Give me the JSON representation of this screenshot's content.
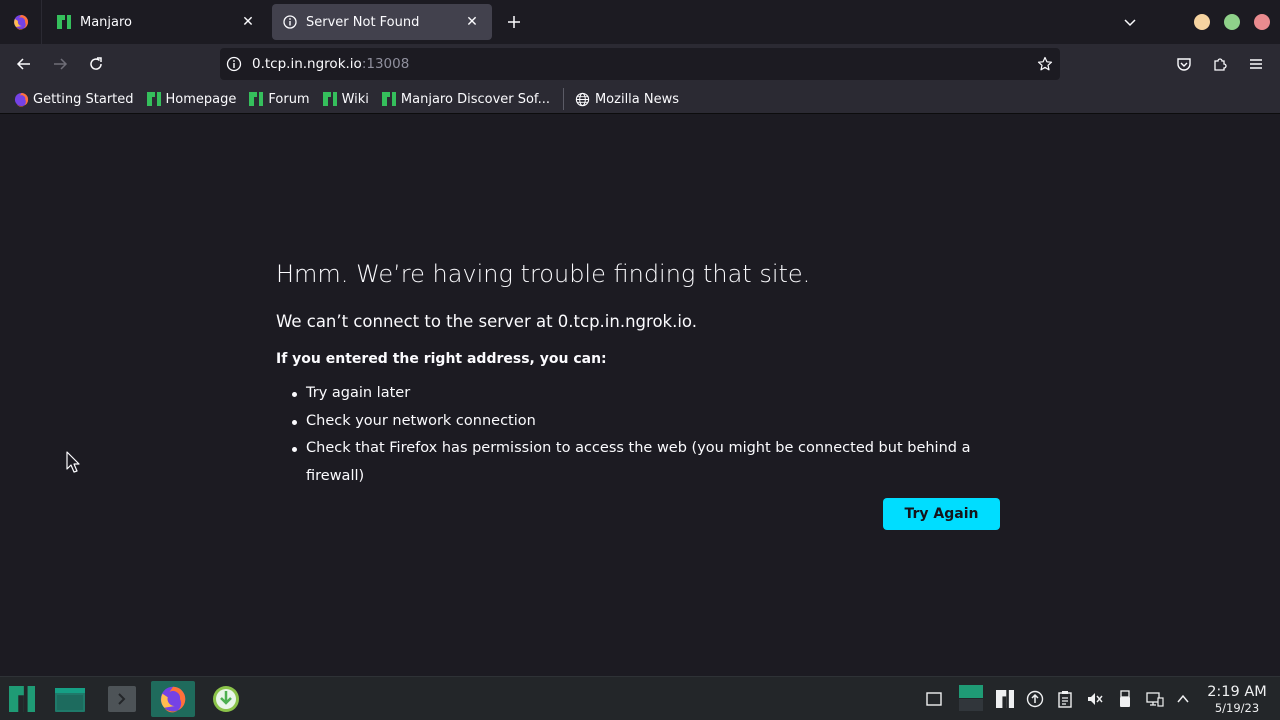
{
  "tabs": [
    {
      "title": "Manjaro",
      "icon": "manjaro-icon",
      "active": false
    },
    {
      "title": "Server Not Found",
      "icon": "info-icon",
      "active": true
    }
  ],
  "url": {
    "host": "0.tcp.in.ngrok.io",
    "port": ":13008"
  },
  "bookmarks": [
    {
      "label": "Getting Started",
      "icon": "firefox-icon"
    },
    {
      "label": "Homepage",
      "icon": "manjaro-icon"
    },
    {
      "label": "Forum",
      "icon": "manjaro-icon"
    },
    {
      "label": "Wiki",
      "icon": "manjaro-icon"
    },
    {
      "label": "Manjaro Discover Sof...",
      "icon": "manjaro-icon"
    },
    {
      "label": "Mozilla News",
      "icon": "globe-icon"
    }
  ],
  "error": {
    "title": "Hmm. We’re having trouble finding that site.",
    "description": "We can’t connect to the server at 0.tcp.in.ngrok.io.",
    "suggestion_heading": "If you entered the right address, you can:",
    "suggestions": [
      "Try again later",
      "Check your network connection",
      "Check that Firefox has permission to access the web (you might be connected but behind a firewall)"
    ],
    "button": "Try Again"
  },
  "taskbar": {
    "time": "2:19 AM",
    "date": "5/19/23"
  },
  "colors": {
    "accent": "#00ddff",
    "manjaro_green": "#35bf5c",
    "background": "#1c1b22",
    "toolbar": "#2b2a33"
  }
}
